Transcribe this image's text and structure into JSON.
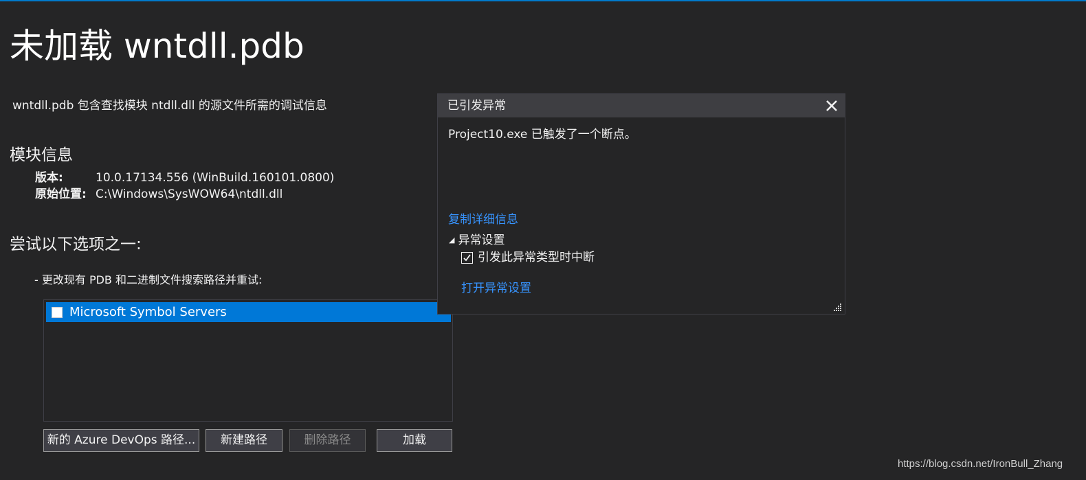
{
  "page": {
    "title": "未加载 wntdll.pdb",
    "description": "wntdll.pdb 包含查找模块 ntdll.dll 的源文件所需的调试信息"
  },
  "module_info": {
    "heading": "模块信息",
    "version_label": "版本:",
    "version_value": "10.0.17134.556 (WinBuild.160101.0800)",
    "location_label": "原始位置:",
    "location_value": "C:\\Windows\\SysWOW64\\ntdll.dll"
  },
  "options": {
    "heading": "尝试以下选项之一:",
    "item1": "-  更改现有 PDB 和二进制文件搜索路径并重试:",
    "symbol_servers": [
      {
        "label": "Microsoft Symbol Servers",
        "checked": false,
        "selected": true
      }
    ]
  },
  "buttons": {
    "azure": "新的 Azure DevOps 路径...",
    "new_path": "新建路径",
    "delete_path": "删除路径",
    "load": "加载"
  },
  "exception_popup": {
    "title": "已引发异常",
    "message": "Project10.exe 已触发了一个断点。",
    "copy_details": "复制详细信息",
    "settings_heading": "异常设置",
    "break_when_thrown": "引发此异常类型时中断",
    "break_checked": true,
    "open_settings": "打开异常设置"
  },
  "watermark": "https://blog.csdn.net/IronBull_Zhang",
  "colors": {
    "background": "#252526",
    "accent": "#007acc",
    "selection": "#0078d7",
    "link": "#3794ff"
  }
}
